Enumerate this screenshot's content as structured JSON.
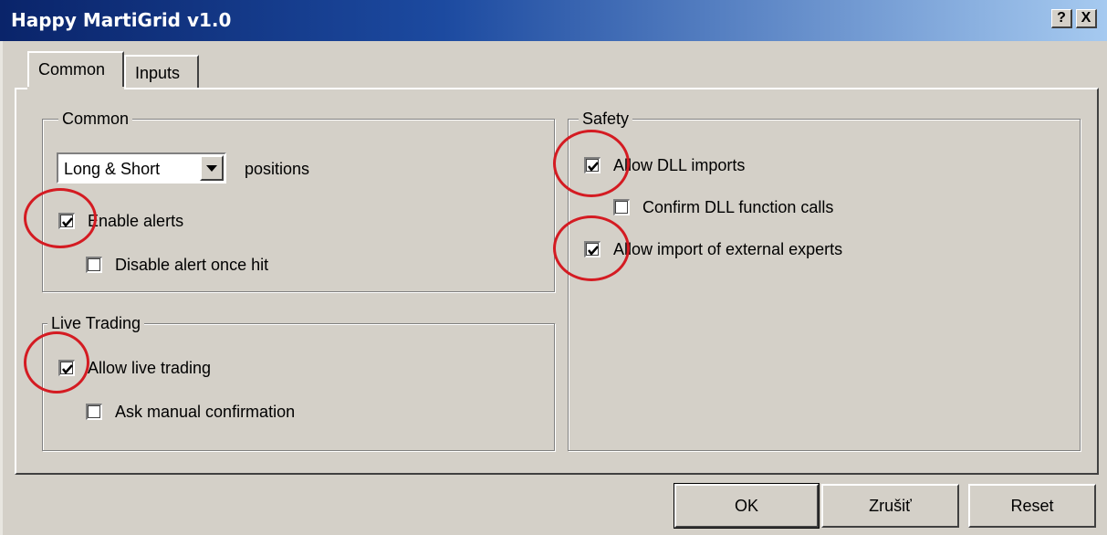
{
  "window": {
    "title": "Happy MartiGrid v1.0",
    "help_label": "?",
    "close_label": "X"
  },
  "tabs": [
    {
      "label": "Common",
      "active": true
    },
    {
      "label": "Inputs",
      "active": false
    }
  ],
  "common_group": {
    "title": "Common",
    "positions_select": {
      "value": "Long & Short",
      "suffix": "positions"
    },
    "enable_alerts": {
      "label": "Enable alerts",
      "checked": true
    },
    "disable_alert_once_hit": {
      "label": "Disable alert once hit",
      "checked": false
    }
  },
  "live_trading_group": {
    "title": "Live Trading",
    "allow_live_trading": {
      "label": "Allow live trading",
      "checked": true
    },
    "ask_manual_confirmation": {
      "label": "Ask manual confirmation",
      "checked": false
    }
  },
  "safety_group": {
    "title": "Safety",
    "allow_dll_imports": {
      "label": "Allow DLL imports",
      "checked": true
    },
    "confirm_dll_function_calls": {
      "label": "Confirm DLL function calls",
      "checked": false
    },
    "allow_import_external_experts": {
      "label": "Allow import of external experts",
      "checked": true
    }
  },
  "buttons": {
    "ok": "OK",
    "cancel": "Zrušiť",
    "reset": "Reset"
  },
  "colors": {
    "titlebar_start": "#0a246a",
    "titlebar_end": "#a6caf0",
    "annotation_ring": "#d41b22",
    "face": "#d4d0c8"
  },
  "icons": {
    "dropdown": "chevron-down-icon",
    "check": "checkmark-icon"
  }
}
